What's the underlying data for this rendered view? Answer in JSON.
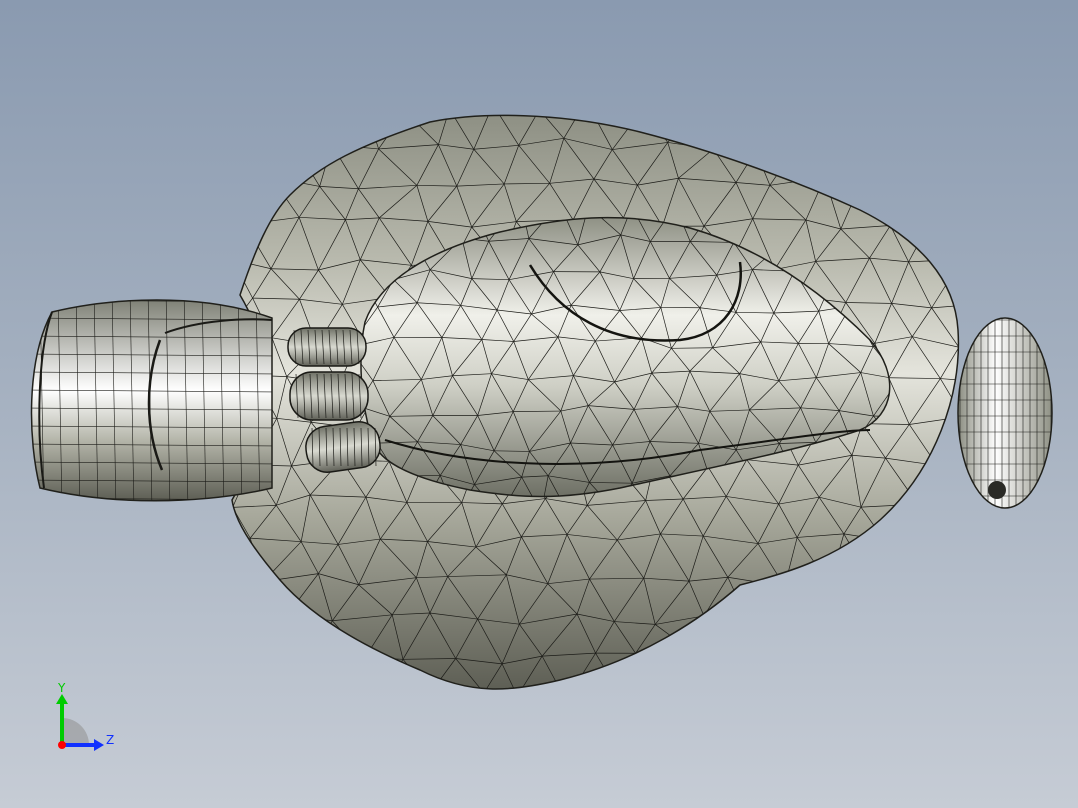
{
  "viewport": {
    "colors": {
      "background_top": "#8a9ab0",
      "background_bottom": "#c6ccd5",
      "model_fill": "#9a9c8c",
      "mesh_line": "#1a1a16"
    }
  },
  "triad": {
    "y_label": "Y",
    "z_label": "Z",
    "colors": {
      "y_axis": "#00cc00",
      "z_axis": "#1030ff",
      "x_axis": "#ff0000"
    }
  }
}
